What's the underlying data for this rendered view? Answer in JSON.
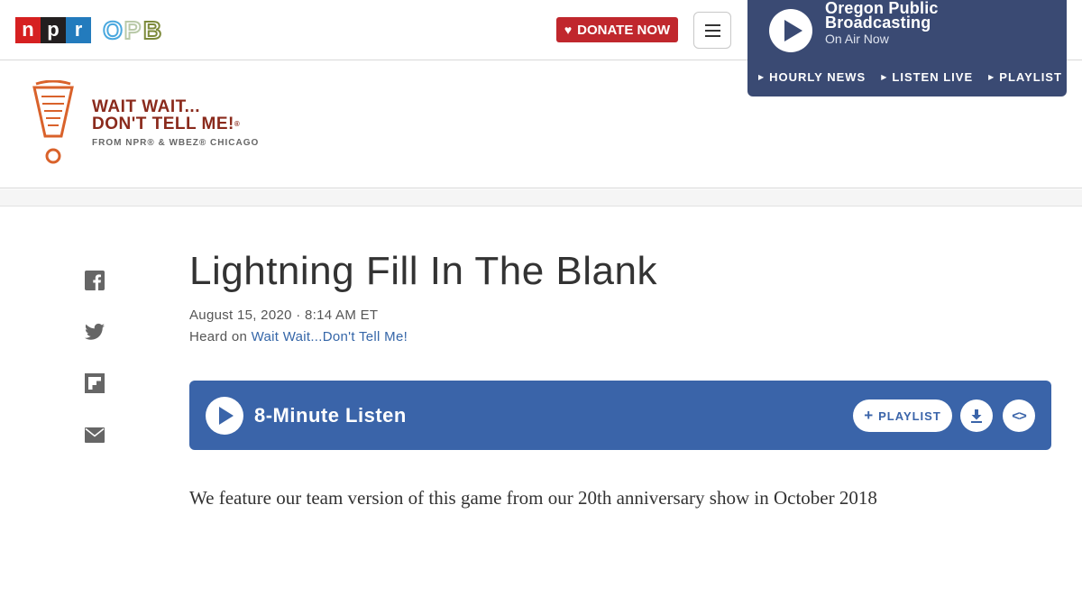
{
  "header": {
    "npr_logo": {
      "n": "n",
      "p": "p",
      "r": "r"
    },
    "opb_logo": {
      "o": "O",
      "p": "P",
      "b": "B"
    },
    "donate_label": "DONATE NOW",
    "menu_icon": "hamburger-icon"
  },
  "on_air": {
    "station": "Oregon Public Broadcasting",
    "status": "On Air Now",
    "links": [
      "HOURLY NEWS",
      "LISTEN LIVE",
      "PLAYLIST"
    ]
  },
  "show": {
    "title_line1": "WAIT WAIT...",
    "title_line2": "DON'T TELL ME!",
    "subtitle": "FROM NPR® & WBEZ® CHICAGO"
  },
  "share_icons": [
    "facebook-icon",
    "twitter-icon",
    "flipboard-icon",
    "email-icon"
  ],
  "article": {
    "title": "Lightning Fill In The Blank",
    "date": "August 15, 2020 · 8:14 AM ET",
    "heard_prefix": "Heard on ",
    "heard_link": "Wait Wait...Don't Tell Me!",
    "body": "We feature our team version of this game from our 20th anniversary show in October 2018"
  },
  "player": {
    "label": "8-Minute Listen",
    "playlist_label": "PLAYLIST",
    "embed_glyph": "<>"
  },
  "colors": {
    "npr_red": "#d62021",
    "npr_blue": "#237bbd",
    "donate": "#c0272d",
    "on_air_bg": "#3a4a73",
    "player_bg": "#3a64a9",
    "link": "#3566a8",
    "show_brand": "#8a2a1c"
  }
}
